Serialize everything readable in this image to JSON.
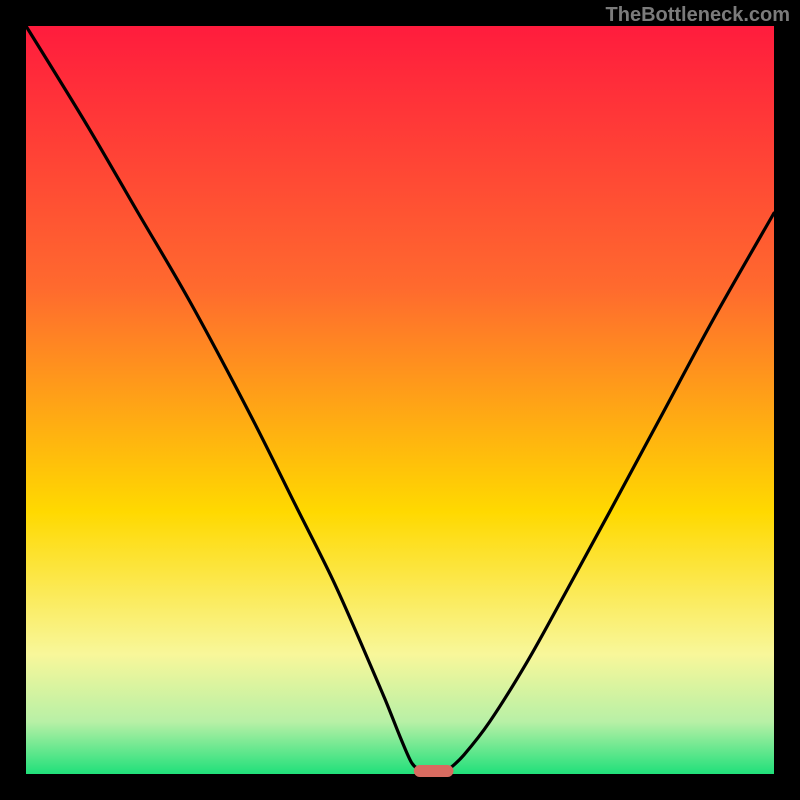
{
  "attribution": "TheBottleneck.com",
  "colors": {
    "frame": "#000000",
    "curve": "#000000",
    "marker_fill": "#d86b60",
    "gradient_top": "#ff1c3d",
    "gradient_mid1": "#ff6a2e",
    "gradient_mid2": "#ffd900",
    "gradient_low1": "#f8f79a",
    "gradient_low2": "#b8f0a6",
    "gradient_bottom": "#20e07a"
  },
  "chart_data": {
    "type": "line",
    "title": "",
    "xlabel": "",
    "ylabel": "",
    "xlim": [
      0,
      100
    ],
    "ylim": [
      0,
      100
    ],
    "series": [
      {
        "name": "left-branch",
        "x": [
          0,
          8,
          15,
          22,
          30,
          36,
          41,
          45,
          48,
          50,
          51.5,
          52.5
        ],
        "values": [
          100,
          87,
          75,
          63,
          48,
          36,
          26,
          17,
          10,
          5,
          1.6,
          0.6
        ]
      },
      {
        "name": "right-branch",
        "x": [
          56.5,
          58.5,
          62,
          67,
          72,
          78,
          85,
          92,
          100
        ],
        "values": [
          0.6,
          2.5,
          7,
          15,
          24,
          35,
          48,
          61,
          75
        ]
      }
    ],
    "marker": {
      "x_center": 54.5,
      "width": 5.3,
      "y": 0.4
    },
    "gradient_stops_pct": {
      "top": 0,
      "mid1": 35,
      "mid2": 65,
      "low1": 84,
      "low2": 93,
      "bottom": 100
    }
  }
}
